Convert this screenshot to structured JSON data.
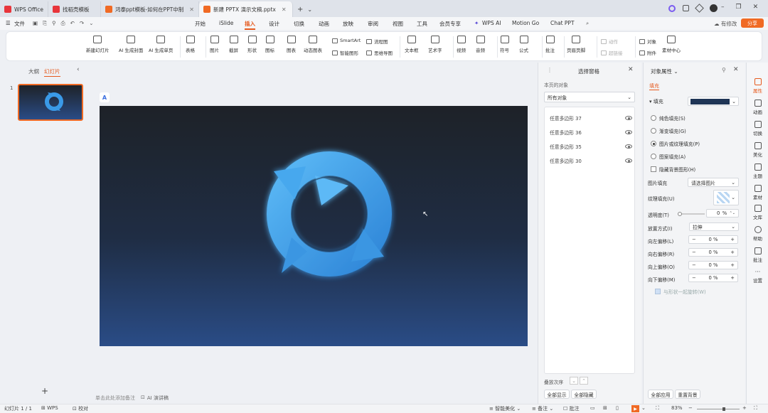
{
  "tabs": [
    {
      "label": "WPS Office",
      "color": "#e8353b",
      "active": false
    },
    {
      "label": "找稻壳模板",
      "color": "#e8353b",
      "active": false
    },
    {
      "label": "鸿泰ppt模板-如何在PPT中制作…",
      "color": "#f06a24",
      "active": false
    },
    {
      "label": "新建 PPTX 演示文稿.pptx",
      "color": "#f06a24",
      "active": true
    }
  ],
  "window": {
    "add_tab": "+",
    "tab_menu": "⌄",
    "min": "–",
    "max": "❐",
    "close": "✕"
  },
  "menu": {
    "file": "文件",
    "items": [
      "开始",
      "iSlide",
      "插入",
      "设计",
      "切换",
      "动画",
      "放映",
      "审阅",
      "视图",
      "工具",
      "会员专享",
      "WPS AI",
      "Motion Go",
      "Chat PPT"
    ],
    "active": "插入",
    "right_edit": "有修改",
    "share": "分享"
  },
  "ribbon": {
    "new_slide": "新建幻灯片",
    "ai_cover": "AI 生成封面",
    "ai_single": "AI 生成单页",
    "table": "表格",
    "image": "图片",
    "screenshot": "截屏",
    "shape": "形状",
    "icon": "图标",
    "chart": "图表",
    "dynamic_chart": "动态图表",
    "smartart": "SmartArt",
    "smart_graph": "智能图形",
    "flowchart": "流程图",
    "mindmap": "思维导图",
    "textbox": "文本框",
    "wordart": "艺术字",
    "video": "视频",
    "audio": "音频",
    "symbol": "符号",
    "formula": "公式",
    "comment": "批注",
    "header_footer": "页眉页脚",
    "action": "动作",
    "hyperlink": "超链接",
    "object": "对象",
    "attachment": "附件",
    "material": "素材中心"
  },
  "left_panel": {
    "outline": "大纲",
    "slides": "幻灯片",
    "slide_number": "1",
    "add": "+"
  },
  "canvas": {
    "notes_placeholder": "单击此处添加备注",
    "ai_notes": "AI 演讲稿"
  },
  "selection_pane": {
    "title": "选择窗格",
    "section": "本页的对象",
    "filter": "所有对象",
    "objects": [
      "任意多边形 37",
      "任意多边形 36",
      "任意多边形 35",
      "任意多边形 30"
    ],
    "order_label": "叠放次序",
    "show_all": "全部显示",
    "hide_all": "全部隐藏"
  },
  "properties": {
    "title": "对象属性",
    "fill_tab": "填充",
    "fill_section": "填充",
    "fill_color": "#1f3556",
    "options": [
      "纯色填充(S)",
      "渐变填充(G)",
      "图片或纹理填充(P)",
      "图案填充(A)"
    ],
    "selected_option": 2,
    "hide_bg": "隐藏背景图形(H)",
    "picture_fill_label": "图片填充",
    "picture_fill_value": "请选择图片",
    "texture_label": "纹理填充(U)",
    "transparency_label": "透明度(T)",
    "transparency_value": "0",
    "transparency_unit": "%",
    "placement_label": "放置方式(I)",
    "placement_value": "拉伸",
    "offsets": [
      {
        "label": "向左偏移(L)",
        "value": "0",
        "unit": "%"
      },
      {
        "label": "向右偏移(R)",
        "value": "0",
        "unit": "%"
      },
      {
        "label": "向上偏移(O)",
        "value": "0",
        "unit": "%"
      },
      {
        "label": "向下偏移(M)",
        "value": "0",
        "unit": "%"
      }
    ],
    "rotate_with_shape": "与形状一起旋转(W)",
    "apply_all": "全部应用",
    "reset_bg": "重置背景"
  },
  "right_bar": [
    "属性",
    "动画",
    "切换",
    "美化",
    "主题",
    "素材",
    "文库",
    "帮助",
    "批注",
    "设置"
  ],
  "status": {
    "slide_counter": "幻灯片 1 / 1",
    "wps": "WPS",
    "proofread": "校对",
    "smart_beautify": "智能美化",
    "notes": "备注",
    "comment": "批注",
    "zoom": "83%"
  }
}
